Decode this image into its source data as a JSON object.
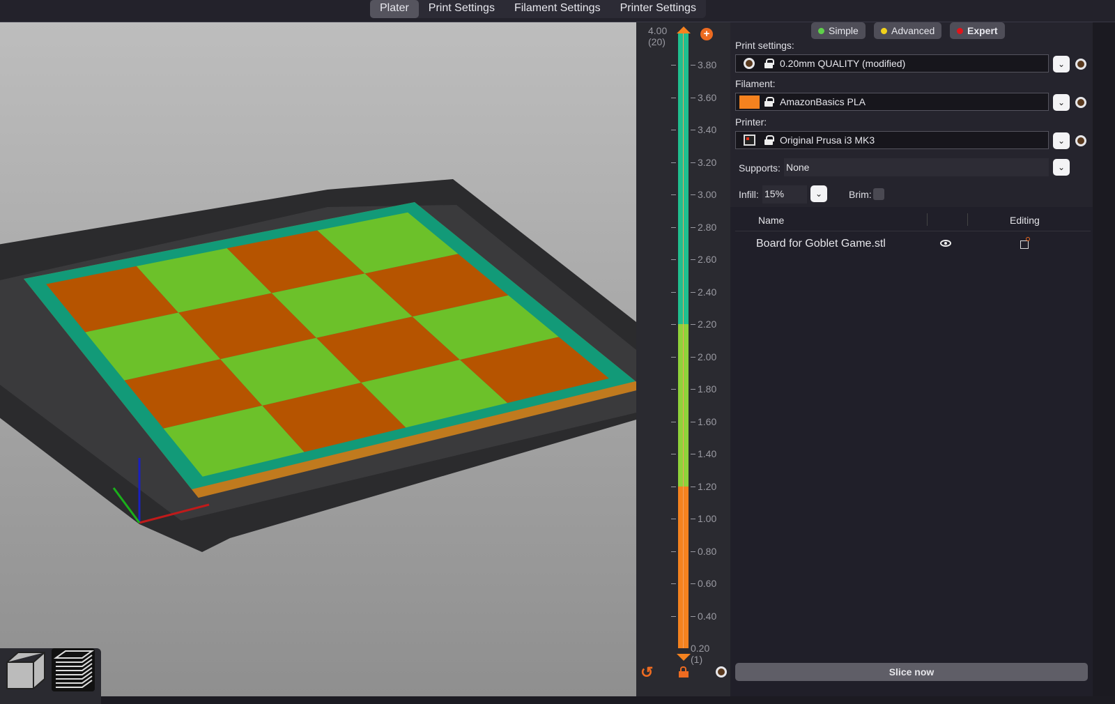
{
  "tabs": [
    {
      "label": "Plater",
      "active": true
    },
    {
      "label": "Print Settings"
    },
    {
      "label": "Filament Settings"
    },
    {
      "label": "Printer Settings"
    }
  ],
  "modes": [
    {
      "label": "Simple",
      "color": "#5fd14a"
    },
    {
      "label": "Advanced",
      "color": "#f2d21b"
    },
    {
      "label": "Expert",
      "color": "#e0151b"
    }
  ],
  "print_settings": {
    "label": "Print settings:",
    "value": "0.20mm QUALITY (modified)",
    "icon": "gear-icon"
  },
  "filament": {
    "label": "Filament:",
    "value": "AmazonBasics PLA",
    "color": "#f5821f"
  },
  "printer": {
    "label": "Printer:",
    "value": "Original Prusa i3 MK3",
    "icon": "printer-icon"
  },
  "supports": {
    "label": "Supports:",
    "value": "None"
  },
  "infill": {
    "label": "Infill:",
    "value": "15%"
  },
  "brim": {
    "label": "Brim:",
    "checked": false
  },
  "objects": {
    "headers": [
      "Name",
      "Editing"
    ],
    "rows": [
      {
        "name": "Board for Goblet Game.stl"
      }
    ]
  },
  "slice_label": "Slice now",
  "layer_slider": {
    "top_value": "4.00",
    "top_layer": "(20)",
    "bottom_value": "0.20",
    "bottom_layer": "(1)",
    "ticks": [
      "3.80",
      "3.60",
      "3.40",
      "3.20",
      "3.00",
      "2.80",
      "2.60",
      "2.40",
      "2.20",
      "2.00",
      "1.80",
      "1.60",
      "1.40",
      "1.20",
      "1.00",
      "0.80",
      "0.60",
      "0.40"
    ],
    "segments": [
      {
        "from": 2.2,
        "to": 4.0,
        "color": "#1fbf8f"
      },
      {
        "from": 1.2,
        "to": 2.2,
        "color": "#8fd23a"
      },
      {
        "from": 0.2,
        "to": 1.2,
        "color": "#f5821f"
      }
    ]
  },
  "colors": {
    "orange": "#b65400",
    "green": "#6cc12a",
    "perimeter": "#129a78",
    "accent": "#ed6b21"
  }
}
